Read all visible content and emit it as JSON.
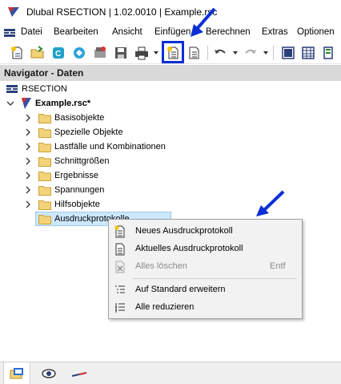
{
  "window": {
    "title": "Dlubal RSECTION | 1.02.0010 | Example.rsc"
  },
  "menubar": {
    "items": [
      "Datei",
      "Bearbeiten",
      "Ansicht",
      "Einfügen",
      "Berechnen",
      "Extras",
      "Optionen"
    ]
  },
  "toolbar": {
    "buttons": [
      "new-icon",
      "open-icon",
      "dlubal-center-icon",
      "model-icon",
      "webservice-icon",
      "save-icon",
      "print-icon",
      "printout-report-icon",
      "printout-icon",
      "undo-icon",
      "redo-icon",
      "view-icon",
      "table-icon",
      "panel-icon"
    ],
    "highlight_color": "#0a2fd6"
  },
  "navigator": {
    "header": "Navigator - Daten",
    "root": "RSECTION",
    "file": "Example.rsc*",
    "folders": [
      "Basisobjekte",
      "Spezielle Objekte",
      "Lastfälle und Kombinationen",
      "Schnittgrößen",
      "Ergebnisse",
      "Spannungen",
      "Hilfsobjekte"
    ],
    "selected": "Ausdruckprotokolle"
  },
  "context_menu": {
    "items": [
      {
        "label": "Neues Ausdruckprotokoll",
        "shortcut": "",
        "enabled": true,
        "icon": "new-printout-icon"
      },
      {
        "label": "Aktuelles Ausdruckprotokoll",
        "shortcut": "",
        "enabled": true,
        "icon": "current-printout-icon"
      },
      {
        "label": "Alles löschen",
        "shortcut": "Entf",
        "enabled": false,
        "icon": "delete-all-icon"
      },
      {
        "label": "Auf Standard erweitern",
        "shortcut": "",
        "enabled": true,
        "icon": "expand-icon"
      },
      {
        "label": "Alle reduzieren",
        "shortcut": "",
        "enabled": true,
        "icon": "collapse-icon"
      }
    ]
  },
  "bottom_tabs": [
    "data-tab-icon",
    "display-tab-icon",
    "views-tab-icon"
  ],
  "colors": {
    "accent": "#0a2fd6",
    "folder": "#f3d37a",
    "selection": "#cce8ff"
  }
}
